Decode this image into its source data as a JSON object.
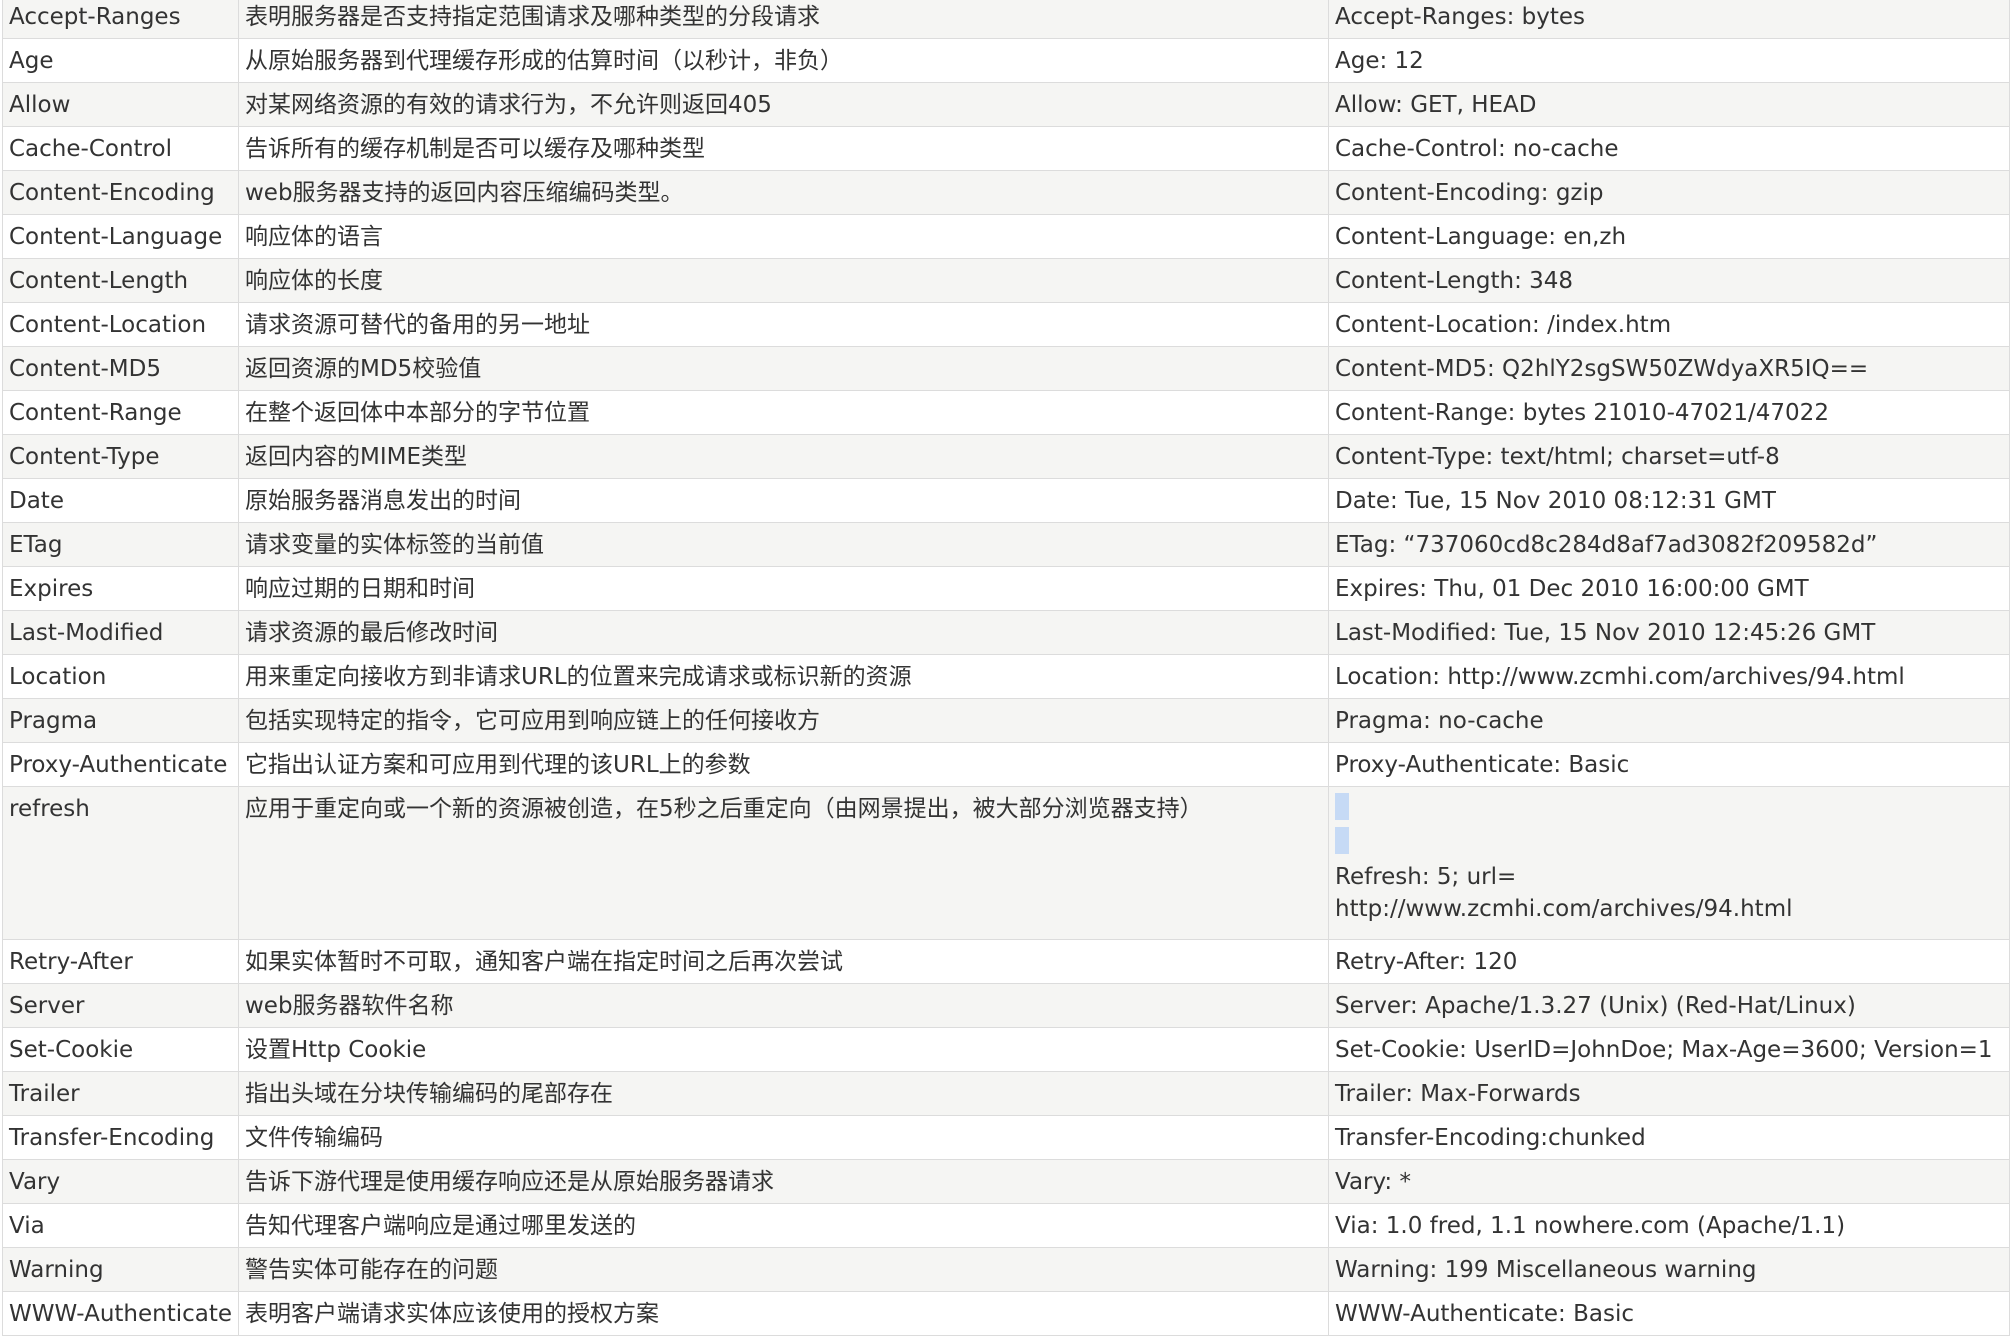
{
  "rows": [
    {
      "name": "Accept-Ranges",
      "description": "表明服务器是否支持指定范围请求及哪种类型的分段请求",
      "example": "Accept-Ranges: bytes"
    },
    {
      "name": "Age",
      "description": "从原始服务器到代理缓存形成的估算时间（以秒计，非负）",
      "example": "Age: 12"
    },
    {
      "name": "Allow",
      "description": "对某网络资源的有效的请求行为，不允许则返回405",
      "example": "Allow: GET, HEAD"
    },
    {
      "name": "Cache-Control",
      "description": "告诉所有的缓存机制是否可以缓存及哪种类型",
      "example": "Cache-Control: no-cache"
    },
    {
      "name": "Content-Encoding",
      "description": "web服务器支持的返回内容压缩编码类型。",
      "example": "Content-Encoding: gzip"
    },
    {
      "name": "Content-Language",
      "description": "响应体的语言",
      "example": "Content-Language: en,zh"
    },
    {
      "name": "Content-Length",
      "description": "响应体的长度",
      "example": "Content-Length: 348"
    },
    {
      "name": "Content-Location",
      "description": "请求资源可替代的备用的另一地址",
      "example": "Content-Location: /index.htm"
    },
    {
      "name": "Content-MD5",
      "description": "返回资源的MD5校验值",
      "example": "Content-MD5: Q2hlY2sgSW50ZWdyaXR5IQ=="
    },
    {
      "name": "Content-Range",
      "description": "在整个返回体中本部分的字节位置",
      "example": "Content-Range: bytes 21010-47021/47022"
    },
    {
      "name": "Content-Type",
      "description": "返回内容的MIME类型",
      "example": "Content-Type: text/html; charset=utf-8"
    },
    {
      "name": "Date",
      "description": "原始服务器消息发出的时间",
      "example": "Date: Tue, 15 Nov 2010 08:12:31 GMT"
    },
    {
      "name": "ETag",
      "description": "请求变量的实体标签的当前值",
      "example": "ETag: “737060cd8c284d8af7ad3082f209582d”"
    },
    {
      "name": "Expires",
      "description": "响应过期的日期和时间",
      "example": "Expires: Thu, 01 Dec 2010 16:00:00 GMT"
    },
    {
      "name": "Last-Modified",
      "description": "请求资源的最后修改时间",
      "example": "Last-Modified: Tue, 15 Nov 2010 12:45:26 GMT"
    },
    {
      "name": "Location",
      "description": "用来重定向接收方到非请求URL的位置来完成请求或标识新的资源",
      "example": "Location: http://www.zcmhi.com/archives/94.html"
    },
    {
      "name": "Pragma",
      "description": "包括实现特定的指令，它可应用到响应链上的任何接收方",
      "example": "Pragma: no-cache"
    },
    {
      "name": "Proxy-Authenticate",
      "description": "它指出认证方案和可应用到代理的该URL上的参数",
      "example": "Proxy-Authenticate: Basic"
    },
    {
      "name": "refresh",
      "description": "应用于重定向或一个新的资源被创造，在5秒之后重定向（由网景提出，被大部分浏览器支持）",
      "example_line1": "Refresh: 5; url=",
      "example_line2": "http://www.zcmhi.com/archives/94.html"
    },
    {
      "name": "Retry-After",
      "description": "如果实体暂时不可取，通知客户端在指定时间之后再次尝试",
      "example": "Retry-After: 120"
    },
    {
      "name": "Server",
      "description": "web服务器软件名称",
      "example": "Server: Apache/1.3.27 (Unix) (Red-Hat/Linux)"
    },
    {
      "name": "Set-Cookie",
      "description": "设置Http Cookie",
      "example": "Set-Cookie: UserID=JohnDoe; Max-Age=3600; Version=1"
    },
    {
      "name": "Trailer",
      "description": "指出头域在分块传输编码的尾部存在",
      "example": "Trailer: Max-Forwards"
    },
    {
      "name": "Transfer-Encoding",
      "description": "文件传输编码",
      "example": "Transfer-Encoding:chunked"
    },
    {
      "name": "Vary",
      "description": "告诉下游代理是使用缓存响应还是从原始服务器请求",
      "example": "Vary: *"
    },
    {
      "name": "Via",
      "description": "告知代理客户端响应是通过哪里发送的",
      "example": "Via: 1.0 fred, 1.1 nowhere.com (Apache/1.1)"
    },
    {
      "name": "Warning",
      "description": "警告实体可能存在的问题",
      "example": "Warning: 199 Miscellaneous warning"
    },
    {
      "name": "WWW-Authenticate",
      "description": "表明客户端请求实体应该使用的授权方案",
      "example": "WWW-Authenticate: Basic"
    }
  ],
  "colors": {
    "row_alt": "#f5f5f3",
    "row": "#ffffff",
    "border": "#dcdcdc",
    "selection": "#c6daf5",
    "text": "#333333"
  }
}
